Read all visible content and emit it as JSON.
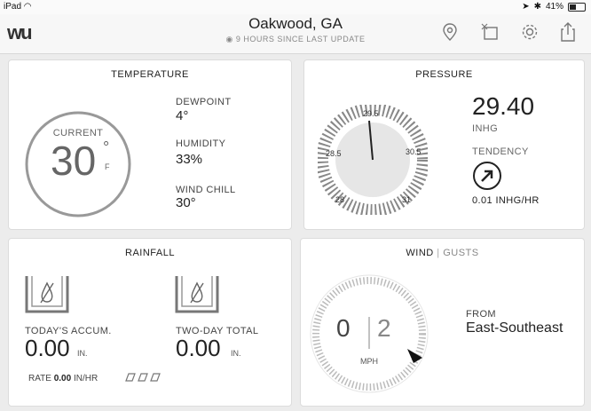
{
  "status_bar": {
    "device": "iPad",
    "battery": "41%"
  },
  "header": {
    "logo": "wu",
    "title": "Oakwood, GA",
    "subtitle": "9 HOURS SINCE LAST UPDATE"
  },
  "temperature": {
    "title": "TEMPERATURE",
    "current_label": "CURRENT",
    "current_value": "30",
    "degree": "°",
    "unit": "F",
    "dewpoint_label": "DEWPOINT",
    "dewpoint_value": "4°",
    "humidity_label": "HUMIDITY",
    "humidity_value": "33%",
    "windchill_label": "WIND CHILL",
    "windchill_value": "30°"
  },
  "pressure": {
    "title": "PRESSURE",
    "value": "29.40",
    "unit": "INHG",
    "tendency_label": "TENDENCY",
    "tendency_value": "0.01 INHG/HR",
    "gauge_labels": [
      "28",
      "28.5",
      "29.5",
      "30.5",
      "31"
    ]
  },
  "rainfall": {
    "title": "RAINFALL",
    "todays_label": "TODAY'S ACCUM.",
    "todays_value": "0.00",
    "twoday_label": "TWO-DAY TOTAL",
    "twoday_value": "0.00",
    "unit": "IN.",
    "rate_label": "RATE",
    "rate_value": "0.00",
    "rate_unit": "IN/HR"
  },
  "wind": {
    "title_wind": "WIND",
    "separator": "|",
    "title_gusts": "GUSTS",
    "speed": "0",
    "gust": "2",
    "unit": "MPH",
    "from_label": "FROM",
    "from_value": "East-Southeast"
  }
}
